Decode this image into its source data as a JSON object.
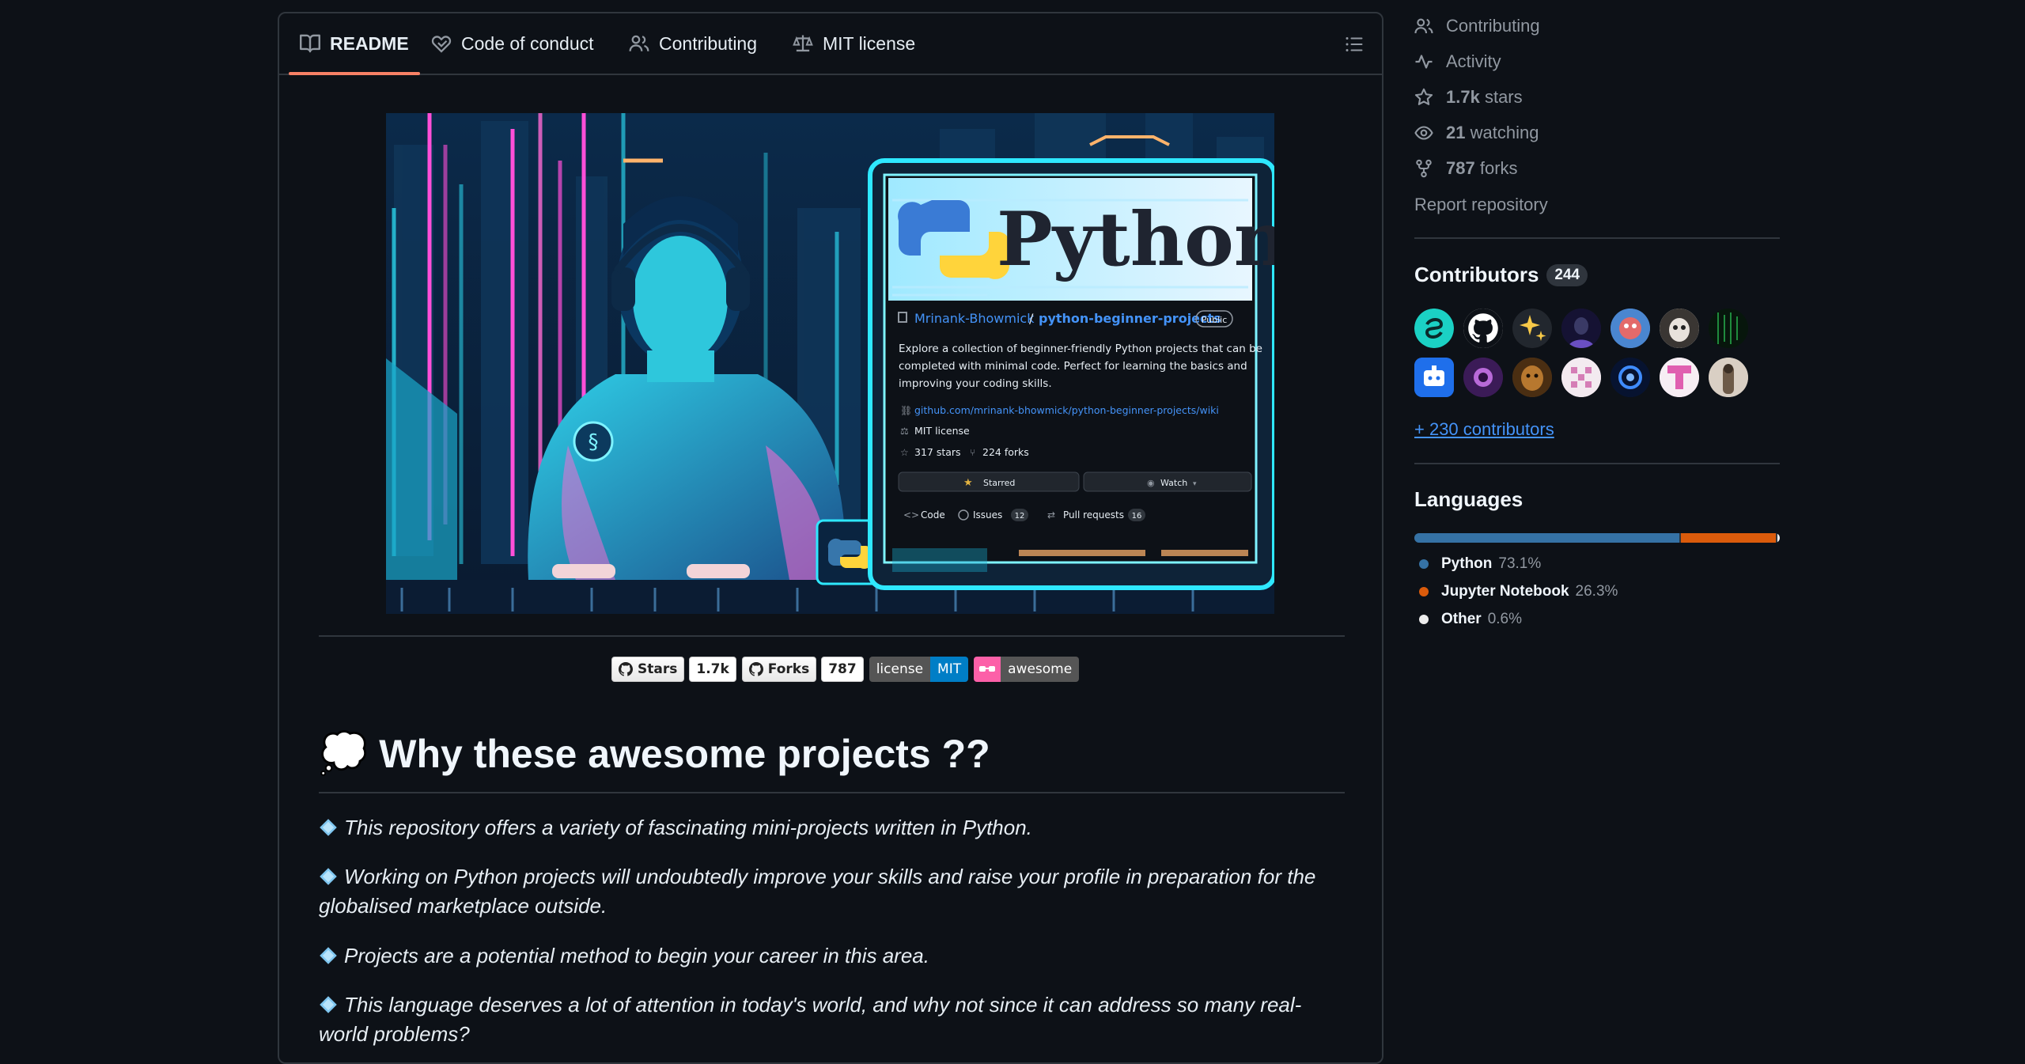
{
  "readme": {
    "tabs": [
      {
        "label": "README"
      },
      {
        "label": "Code of conduct"
      },
      {
        "label": "Contributing"
      },
      {
        "label": "MIT license"
      }
    ],
    "hero": {
      "logo_text": "Python",
      "owner": "Mrinank-Bhowmick",
      "slash": "/",
      "repo": "python-beginner-projects",
      "visibility": "Public",
      "description_lines": [
        "Explore a collection of beginner-friendly Python projects that can be",
        "completed with minimal code. Perfect for learning the basics and",
        "improving your coding skills."
      ],
      "link": "github.com/mrinank-bhowmick/python-beginner-projects/wiki",
      "license": "MIT license",
      "stars": "317 stars",
      "forks": "224 forks",
      "starred_btn": "Starred",
      "watch_btn": "Watch",
      "tab_code": "Code",
      "tab_issues": "Issues",
      "issues_count": "12",
      "tab_pulls": "Pull requests",
      "pulls_count": "16"
    },
    "badges": {
      "stars_label": "Stars",
      "stars_count": "1.7k",
      "forks_label": "Forks",
      "forks_count": "787",
      "license_label": "license",
      "license_value": "MIT",
      "awesome_label": "awesome",
      "license_color": "#007ec6",
      "awesome_color": "#fc60a8"
    },
    "heading": {
      "emoji": "💭",
      "text": "Why these awesome projects ??"
    },
    "paragraphs": [
      {
        "text": "This repository offers a variety of fascinating mini-projects written in Python."
      },
      {
        "text": "Working on Python projects will undoubtedly improve your skills and raise your profile in preparation for the globalised marketplace outside."
      },
      {
        "text": "Projects are a potential method to begin your career in this area."
      },
      {
        "text": "This language deserves a lot of attention in today's world, and why not since it can address so many real-world problems?"
      }
    ]
  },
  "sidebar": {
    "contributing": "Contributing",
    "activity": "Activity",
    "stars_count": "1.7k",
    "stars_label": "stars",
    "watching_count": "21",
    "watching_label": "watching",
    "forks_count": "787",
    "forks_label": "forks",
    "report": "Report repository",
    "contributors_title": "Contributors",
    "contributors_count": "244",
    "more_contributors": "+ 230 contributors",
    "languages_title": "Languages",
    "languages": [
      {
        "name": "Python",
        "percent": "73.1%",
        "value": 73.1,
        "color": "#3572A5"
      },
      {
        "name": "Jupyter Notebook",
        "percent": "26.3%",
        "value": 26.3,
        "color": "#DA5B0B"
      },
      {
        "name": "Other",
        "percent": "0.6%",
        "value": 0.6,
        "color": "#ededed"
      }
    ]
  },
  "colors": {
    "accent_tab": "#f78166",
    "link": "#4493f8",
    "background": "#0d1117",
    "border": "#30363d"
  }
}
